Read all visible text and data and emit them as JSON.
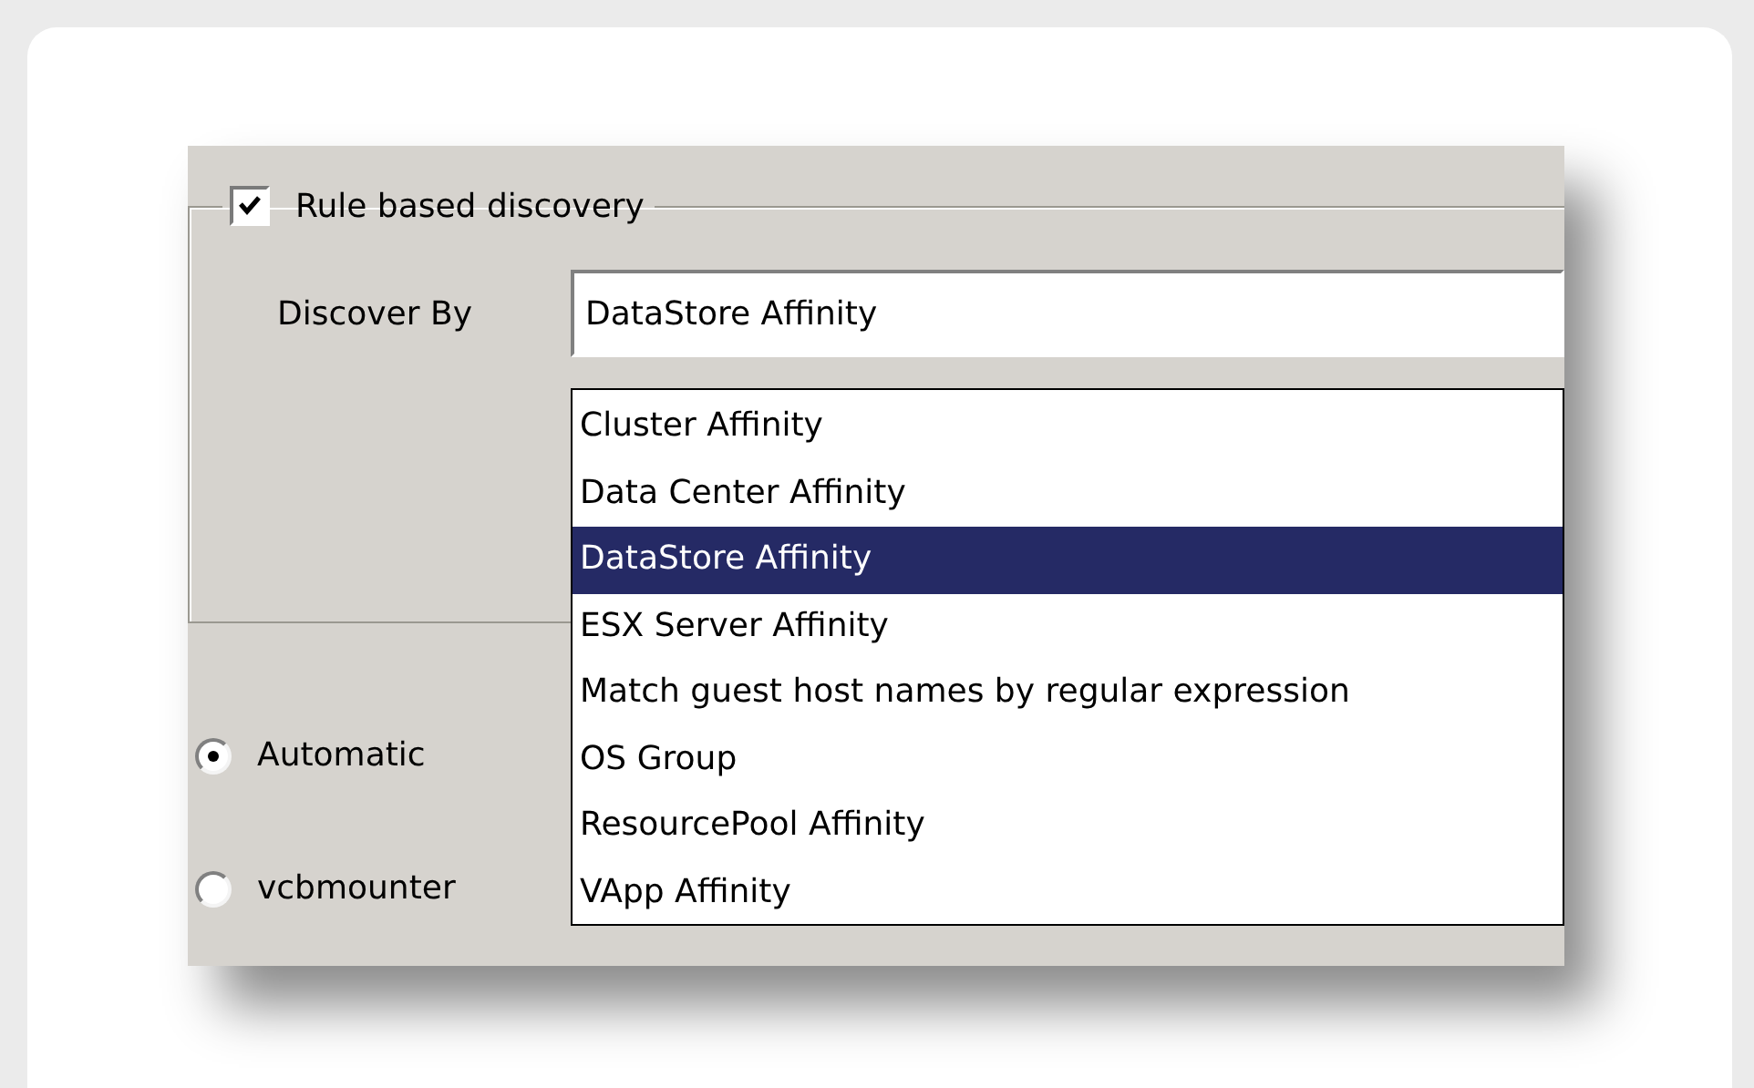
{
  "group": {
    "label": "Rule based discovery",
    "checked": true
  },
  "discover_by": {
    "label": "Discover By",
    "value": "DataStore Affinity"
  },
  "dropdown": {
    "items": [
      {
        "label": "Cluster Affinity",
        "selected": false
      },
      {
        "label": "Data Center Affinity",
        "selected": false
      },
      {
        "label": "DataStore Affinity",
        "selected": true
      },
      {
        "label": "ESX Server Affinity",
        "selected": false
      },
      {
        "label": "Match guest host names by regular expression",
        "selected": false
      },
      {
        "label": "OS Group",
        "selected": false
      },
      {
        "label": "ResourcePool Affinity",
        "selected": false
      },
      {
        "label": "VApp Affinity",
        "selected": false
      }
    ]
  },
  "modes": [
    {
      "label": "Automatic",
      "selected": true
    },
    {
      "label": "vcbmounter",
      "selected": false
    }
  ]
}
